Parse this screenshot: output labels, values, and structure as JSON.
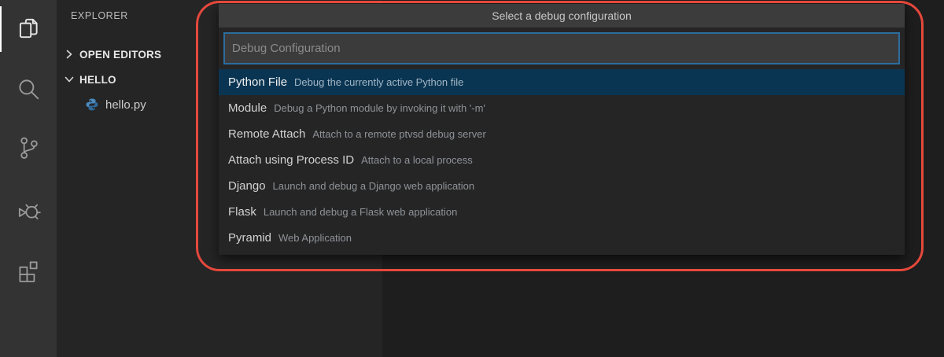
{
  "activity_bar": {
    "items": [
      {
        "icon": "files-icon",
        "name": "explorer",
        "active": true
      },
      {
        "icon": "search-icon",
        "name": "search",
        "active": false
      },
      {
        "icon": "source-control-icon",
        "name": "source-control",
        "active": false
      },
      {
        "icon": "debug-icon",
        "name": "run-and-debug",
        "active": false
      },
      {
        "icon": "extensions-icon",
        "name": "extensions",
        "active": false
      }
    ]
  },
  "sidebar": {
    "title": "EXPLORER",
    "sections": [
      {
        "label": "OPEN EDITORS",
        "state": "collapsed"
      },
      {
        "label": "HELLO",
        "state": "expanded"
      }
    ],
    "files": [
      {
        "name": "hello.py",
        "icon": "python-icon"
      }
    ]
  },
  "quick_pick": {
    "title": "Select a debug configuration",
    "input_placeholder": "Debug Configuration",
    "input_value": "",
    "items": [
      {
        "label": "Python File",
        "description": "Debug the currently active Python file",
        "selected": true
      },
      {
        "label": "Module",
        "description": "Debug a Python module by invoking it with '-m'",
        "selected": false
      },
      {
        "label": "Remote Attach",
        "description": "Attach to a remote ptvsd debug server",
        "selected": false
      },
      {
        "label": "Attach using Process ID",
        "description": "Attach to a local process",
        "selected": false
      },
      {
        "label": "Django",
        "description": "Launch and debug a Django web application",
        "selected": false
      },
      {
        "label": "Flask",
        "description": "Launch and debug a Flask web application",
        "selected": false
      },
      {
        "label": "Pyramid",
        "description": "Web Application",
        "selected": false
      }
    ]
  },
  "colors": {
    "annotation_red": "#e5483b",
    "selected_item_background": "#0a3552",
    "input_focus_border": "#2c6d9c",
    "activity_bar_background": "#333333",
    "sidebar_background": "#252526",
    "editor_background": "#1e1e1e",
    "quickpick_title_background": "#3c3c3c"
  }
}
